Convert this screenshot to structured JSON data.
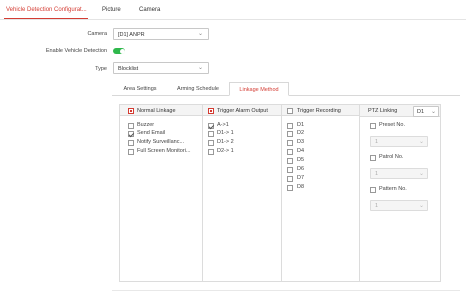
{
  "top_tabs": [
    "Vehicle Detection Configurat...",
    "Picture",
    "Camera"
  ],
  "form": {
    "camera_label": "Camera",
    "camera_value": "[D1] ANPR",
    "enable_label": "Enable Vehicle Detection",
    "enable_on": true,
    "type_label": "Type",
    "type_value": "Blocklist"
  },
  "sub_tabs": [
    "Area Settings",
    "Arming Schedule",
    "Linkage Method"
  ],
  "columns": {
    "normal": {
      "title": "Normal Linkage",
      "items": [
        {
          "label": "Buzzer",
          "checked": false
        },
        {
          "label": "Send Email",
          "checked": true
        },
        {
          "label": "Notify Surveillanc...",
          "checked": false
        },
        {
          "label": "Full Screen Monitori...",
          "checked": false
        }
      ]
    },
    "alarm": {
      "title": "Trigger Alarm Output",
      "items": [
        {
          "label": "A->1",
          "checked": true
        },
        {
          "label": "D1-> 1",
          "checked": false
        },
        {
          "label": "D1-> 2",
          "checked": false
        },
        {
          "label": "D2-> 1",
          "checked": false
        }
      ]
    },
    "recording": {
      "title": "Trigger Recording",
      "items": [
        "D1",
        "D2",
        "D3",
        "D4",
        "D5",
        "D6",
        "D7",
        "D8"
      ]
    },
    "ptz": {
      "title": "PTZ Linking",
      "channel": "D1",
      "preset_label": "Preset No.",
      "preset_value": "1",
      "patrol_label": "Patrol No.",
      "patrol_value": "1",
      "pattern_label": "Pattern No.",
      "pattern_value": "1"
    }
  },
  "colors": {
    "accent": "#d43c33",
    "toggle": "#2fb84c"
  }
}
